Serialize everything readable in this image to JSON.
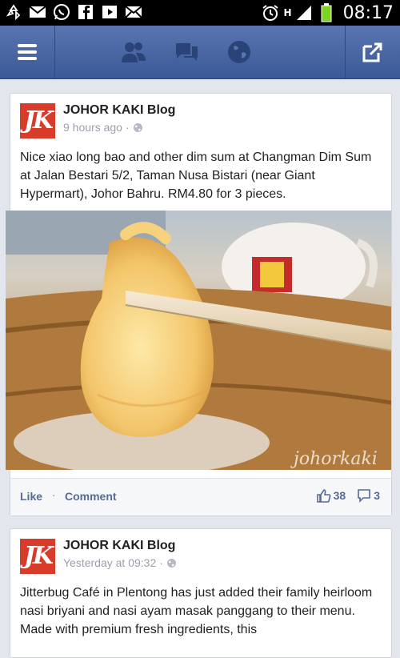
{
  "status_bar": {
    "time": "08:17",
    "signal_h_label": "H"
  },
  "nav": {
    "icons": [
      "menu-icon",
      "friends-icon",
      "messages-icon",
      "globe-icon",
      "share-icon"
    ]
  },
  "posts": [
    {
      "author": "JOHOR KAKI Blog",
      "logo_text": "JK",
      "time": "9 hours ago",
      "text": "Nice xiao long bao and other dim sum at Changman Dim Sum at Jalan Bestari 5/2, Taman Nusa Bistari (near Giant Hypermart), Johor Bahru. RM4.80 for 3 pieces.",
      "watermark": "johorkaki",
      "like_label": "Like",
      "comment_label": "Comment",
      "likes": "38",
      "comments": "3"
    },
    {
      "author": "JOHOR KAKI Blog",
      "logo_text": "JK",
      "time": "Yesterday at 09:32",
      "text": "Jitterbug Café in Plentong has just added their family heirloom nasi briyani and nasi ayam masak panggang to their menu. Made with premium fresh ingredients, this"
    }
  ],
  "colors": {
    "nav_blue": "#3b5998",
    "link_blue": "#576b95",
    "logo_red": "#d93b2b",
    "battery_green": "#7ed321"
  }
}
